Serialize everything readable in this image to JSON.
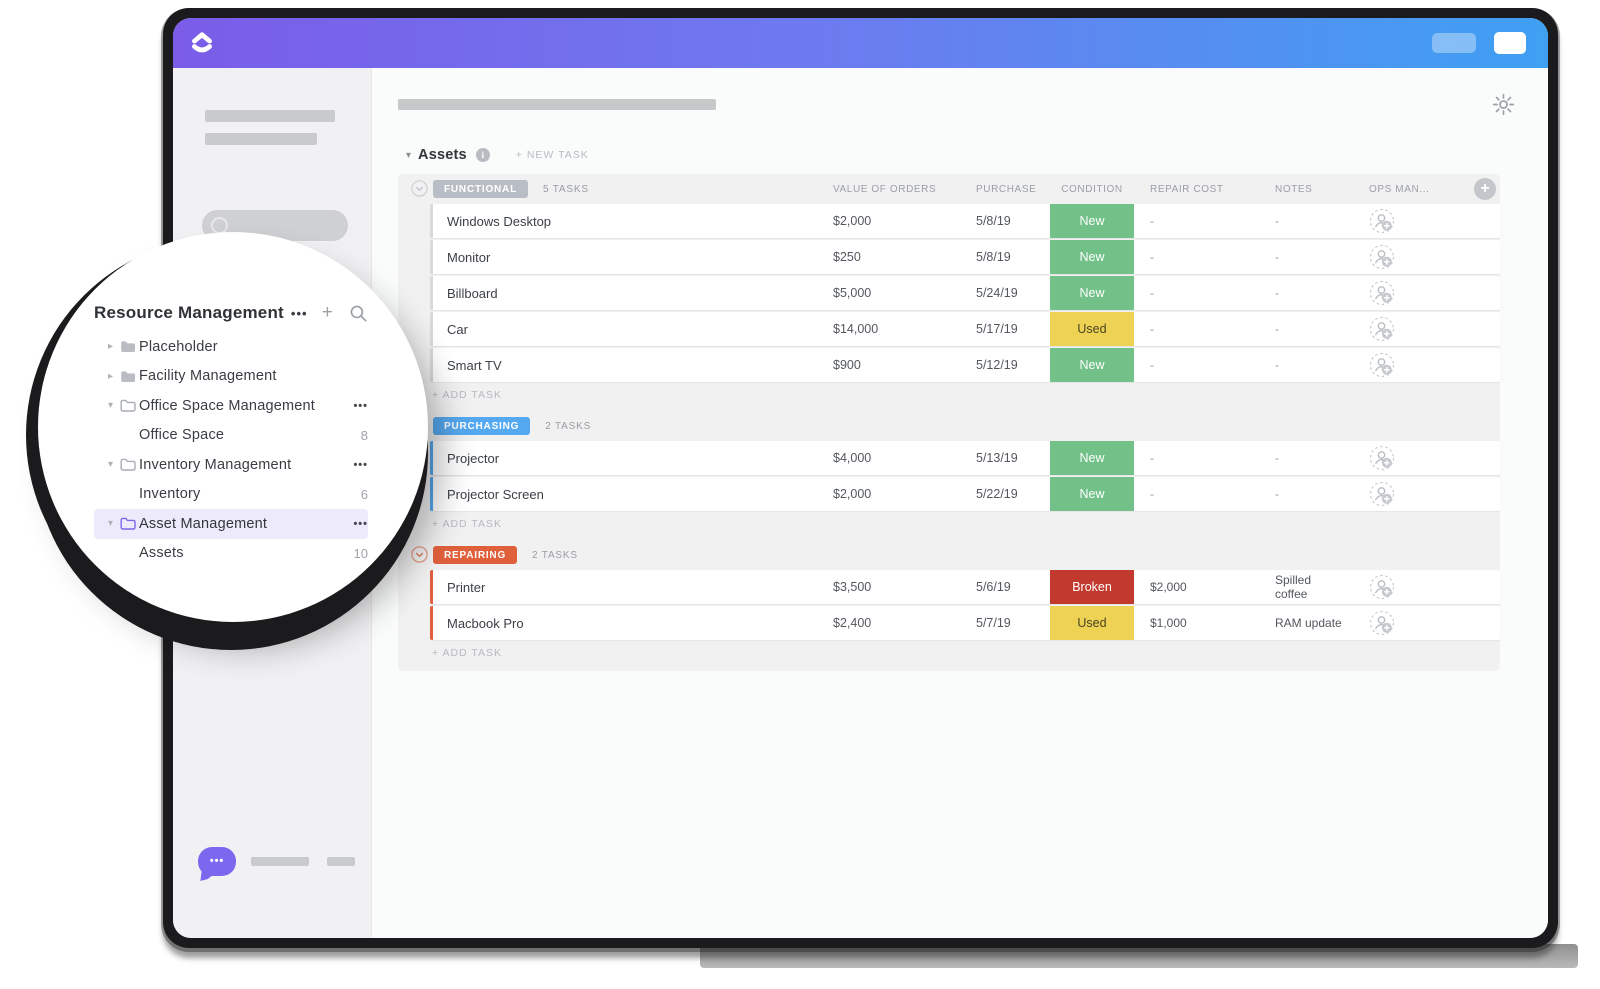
{
  "topbar": {
    "logo_icon": "clickup-logo-icon"
  },
  "sidebar": {
    "chat_dots": "•••"
  },
  "zoom_panel": {
    "title": "Resource Management",
    "menu_dots": "•••",
    "add_icon": "+",
    "tree": [
      {
        "label": "Placeholder",
        "type": "folder-collapsed"
      },
      {
        "label": "Facility Management",
        "type": "folder-collapsed"
      },
      {
        "label": "Office Space Management",
        "type": "folder-expanded",
        "menu_dots": "•••"
      },
      {
        "label": "Office Space",
        "type": "list",
        "count": "8"
      },
      {
        "label": "Inventory Management",
        "type": "folder-expanded",
        "menu_dots": "•••"
      },
      {
        "label": "Inventory",
        "type": "list",
        "count": "6"
      },
      {
        "label": "Asset Management",
        "type": "folder-expanded",
        "menu_dots": "•••",
        "active": true
      },
      {
        "label": "Assets",
        "type": "list",
        "count": "10"
      }
    ]
  },
  "main": {
    "list": {
      "title": "Assets",
      "caret": "▾",
      "info_glyph": "i",
      "new_task_label": "+ NEW TASK",
      "add_task_label": "+ ADD TASK",
      "add_column_glyph": "+"
    },
    "columns": [
      "VALUE OF ORDERS",
      "PURCHASE",
      "CONDITION",
      "REPAIR COST",
      "NOTES",
      "OPS MAN..."
    ],
    "condition_styles": {
      "New": {
        "bg": "#72c188",
        "fg": "#ffffff"
      },
      "Used": {
        "bg": "#eed254",
        "fg": "#4a4423"
      },
      "Broken": {
        "bg": "#c2392e",
        "fg": "#ffffff"
      }
    },
    "functional_strip_color": "#d9dadd",
    "groups": [
      {
        "name": "FUNCTIONAL",
        "color": "#b9bec6",
        "count_label": "5 TASKS",
        "rows": [
          {
            "name": "Windows Desktop",
            "value": "$2,000",
            "purchase": "5/8/19",
            "condition": "New",
            "repair": "-",
            "notes": "-"
          },
          {
            "name": "Monitor",
            "value": "$250",
            "purchase": "5/8/19",
            "condition": "New",
            "repair": "-",
            "notes": "-"
          },
          {
            "name": "Billboard",
            "value": "$5,000",
            "purchase": "5/24/19",
            "condition": "New",
            "repair": "-",
            "notes": "-"
          },
          {
            "name": "Car",
            "value": "$14,000",
            "purchase": "5/17/19",
            "condition": "Used",
            "repair": "-",
            "notes": "-"
          },
          {
            "name": "Smart TV",
            "value": "$900",
            "purchase": "5/12/19",
            "condition": "New",
            "repair": "-",
            "notes": "-"
          }
        ]
      },
      {
        "name": "PURCHASING",
        "color": "#55a9f0",
        "count_label": "2 TASKS",
        "rows": [
          {
            "name": "Projector",
            "value": "$4,000",
            "purchase": "5/13/19",
            "condition": "New",
            "repair": "-",
            "notes": "-"
          },
          {
            "name": "Projector Screen",
            "value": "$2,000",
            "purchase": "5/22/19",
            "condition": "New",
            "repair": "-",
            "notes": "-"
          }
        ]
      },
      {
        "name": "REPAIRING",
        "color": "#e0603c",
        "count_label": "2 TASKS",
        "rows": [
          {
            "name": "Printer",
            "value": "$3,500",
            "purchase": "5/6/19",
            "condition": "Broken",
            "repair": "$2,000",
            "notes": "Spilled coffee"
          },
          {
            "name": "Macbook Pro",
            "value": "$2,400",
            "purchase": "5/7/19",
            "condition": "Used",
            "repair": "$1,000",
            "notes": "RAM update"
          }
        ]
      }
    ]
  }
}
